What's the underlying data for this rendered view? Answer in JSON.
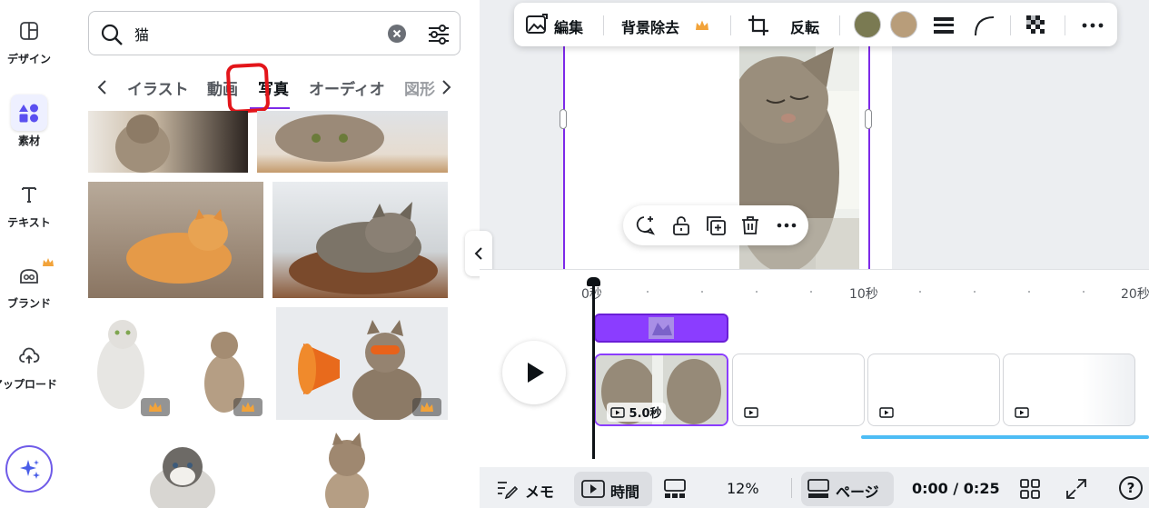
{
  "rail": {
    "items": [
      {
        "label": "デザイン",
        "icon": "layout-icon"
      },
      {
        "label": "素材",
        "icon": "elements-shapes-icon",
        "active": true
      },
      {
        "label": "テキスト",
        "icon": "text-t-icon"
      },
      {
        "label": "ブランド",
        "icon": "brand-icon",
        "premium": true
      },
      {
        "label": "アップロード",
        "icon": "cloud-upload-icon"
      }
    ],
    "magic_icon": "sparkle-icon"
  },
  "search": {
    "value": "猫",
    "icons": [
      "search-icon",
      "clear-icon",
      "filter-sliders-icon"
    ]
  },
  "tabs": {
    "items": [
      "イラスト",
      "動画",
      "写真",
      "オーディオ",
      "図形"
    ],
    "active": "写真"
  },
  "toolbar": {
    "edit_label": "編集",
    "bg_remove_label": "背景除去",
    "flip_label": "反転",
    "swatch_colors": [
      "#7a7a52",
      "#b89d7a"
    ],
    "accent": "#7d2ae8",
    "premium_color": "#f2a33a"
  },
  "timeline": {
    "ruler": [
      "0秒",
      "10秒",
      "20秒"
    ],
    "clip_duration": "5.0秒"
  },
  "footer": {
    "notes_label": "メモ",
    "time_label": "時間",
    "zoom": "12%",
    "page_label": "ページ",
    "playback_time": "0:00 / 0:25",
    "help_label": "?"
  }
}
